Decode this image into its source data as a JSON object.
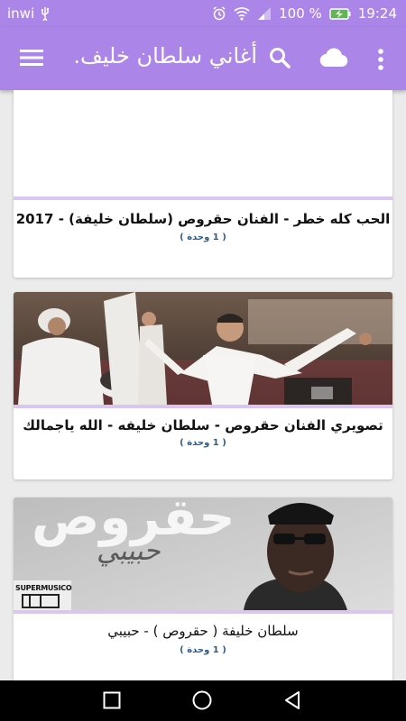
{
  "status_bar": {
    "carrier": "inwi",
    "battery": "100 %",
    "time": "19:24",
    "icons": [
      "usb-icon",
      "alarm-icon",
      "wifi-icon",
      "signal-icon",
      "battery-icon"
    ]
  },
  "app_bar": {
    "title": "أغاني سلطان خليف.",
    "icons": [
      "menu-icon",
      "search-icon",
      "cloud-icon",
      "more-vert-icon"
    ],
    "color": "#ab86e8"
  },
  "videos": [
    {
      "title": "الحب كله خطر - الفنان حقروص (سلطان خليفة) - 2017",
      "meta": "( 1 وحدة )"
    },
    {
      "title": "تصويري الفنان حقروص - سلطان خليفه - الله ياجمالك",
      "meta": "( 1 وحدة )"
    },
    {
      "title": "سلطان خليفة ( حقروص ) - حبيبي",
      "meta": "( 1 وحدة )",
      "thumb_text": "حقروص",
      "thumb_subtext": "حبيبي",
      "logo_text": "SUPERMUSICO"
    }
  ],
  "nav_bar": {
    "icons": [
      "recents-icon",
      "home-icon",
      "back-icon"
    ]
  }
}
